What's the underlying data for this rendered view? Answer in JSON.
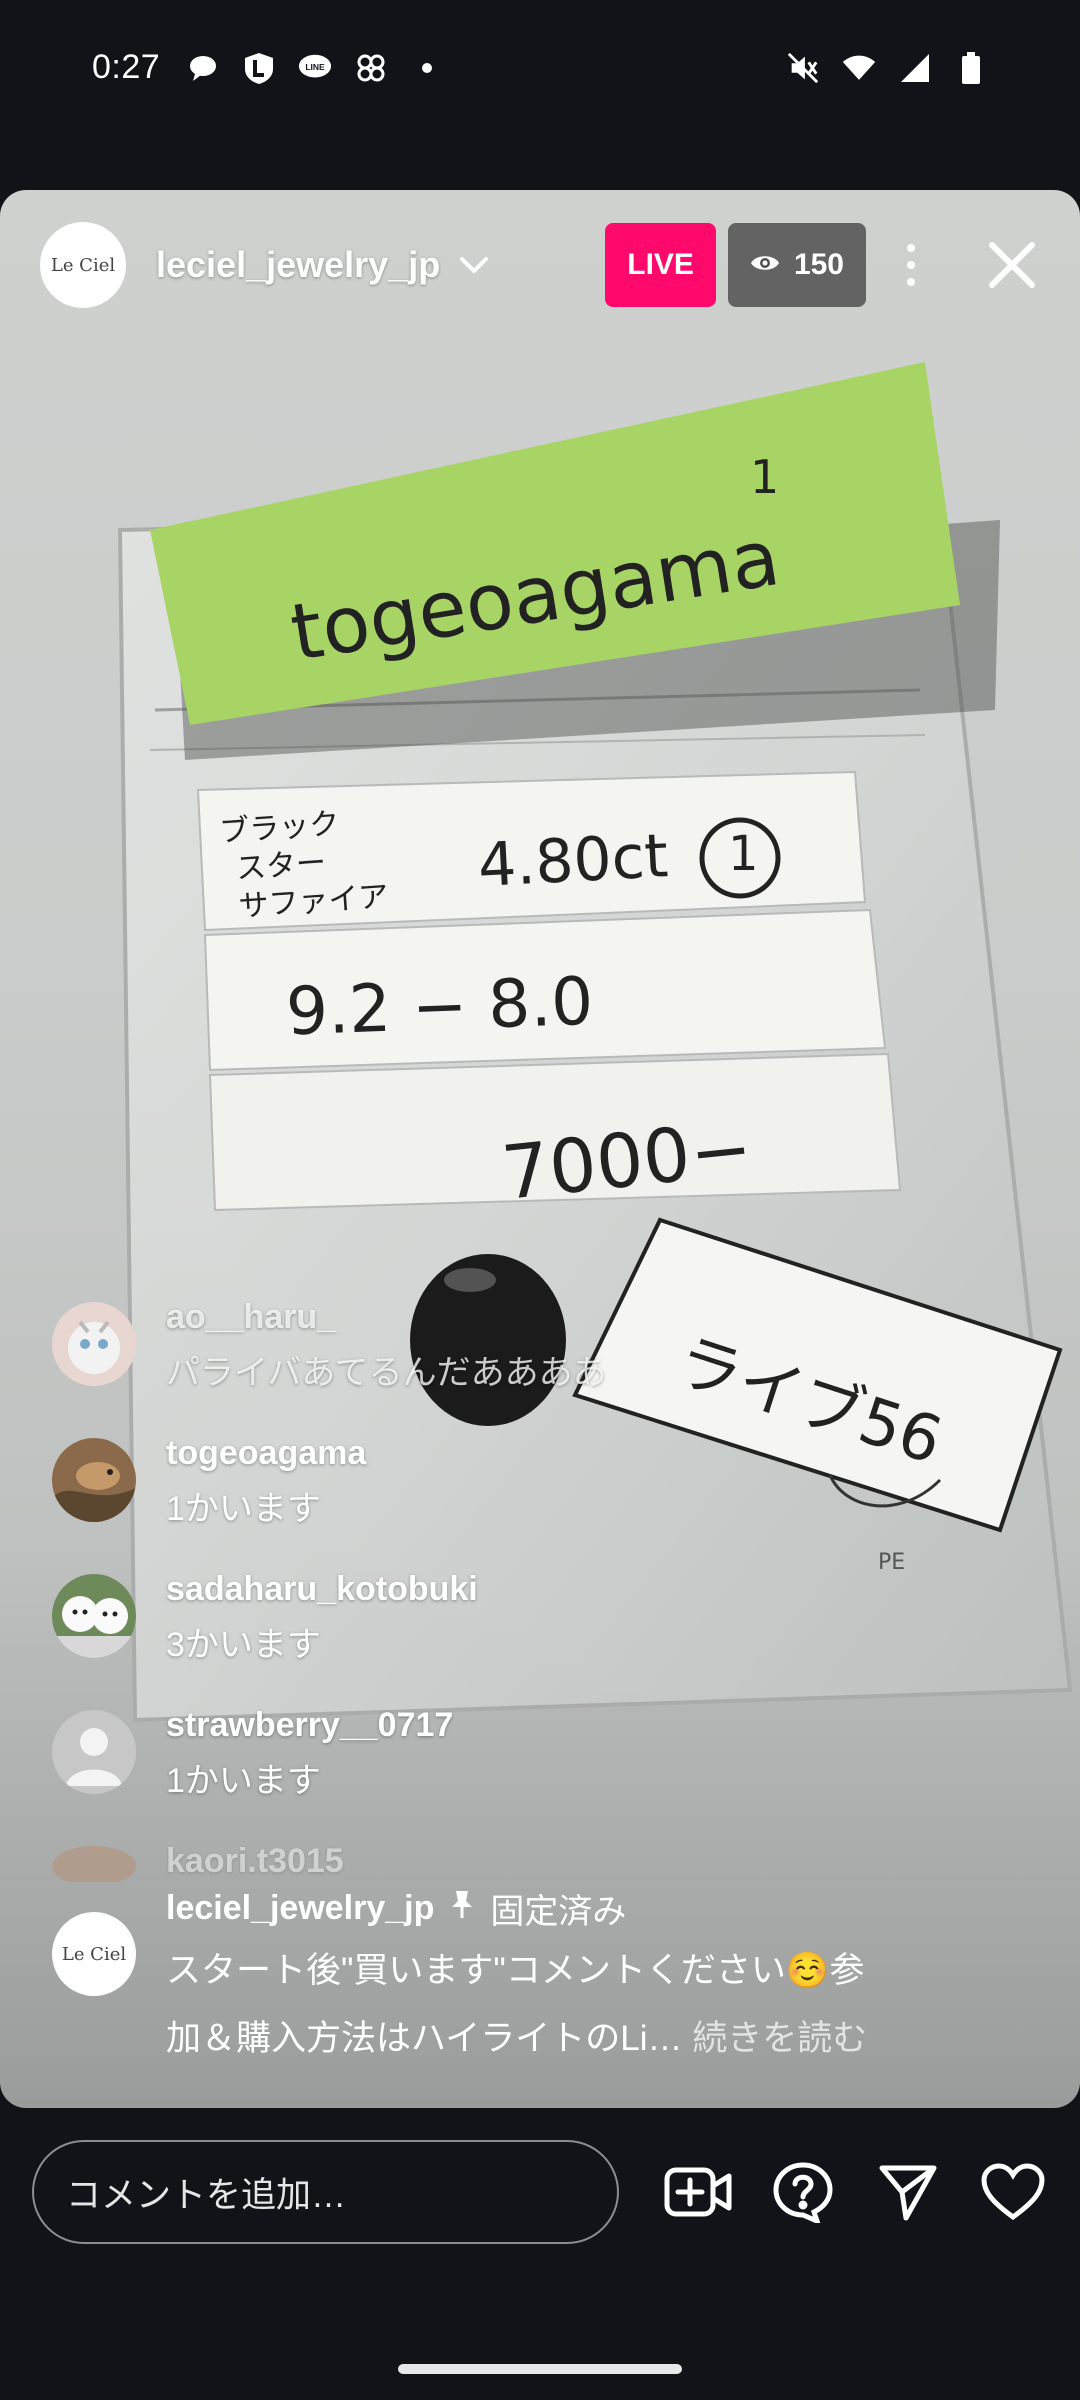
{
  "status_bar": {
    "time": "0:27",
    "left_icons": [
      "chat-bubble-icon",
      "shield-l-icon",
      "line-icon",
      "pinwheel-icon",
      "dot-icon"
    ],
    "right_icons": [
      "mute-icon",
      "wifi-icon",
      "signal-icon",
      "battery-icon"
    ]
  },
  "live": {
    "host": {
      "username": "leciel_jewelry_jp",
      "avatar_text": "Le Ciel"
    },
    "live_label": "LIVE",
    "viewer_count": "150",
    "video": {
      "note_label": "togeoagama",
      "note_number": "1",
      "row1_katakana": [
        "ブラック",
        "スター",
        "サファイア"
      ],
      "row1_weight": "4.80ct",
      "row1_index": "1",
      "row2": "9.2 − 8.0",
      "row3": "7000−",
      "tag": "ライブ56",
      "tag_small": "PE"
    }
  },
  "comments": [
    {
      "user": "ao__haru_",
      "text": "パライバあてるんだああああ",
      "faded": true,
      "avatar": "avatar-ao-haru"
    },
    {
      "user": "togeoagama",
      "text": "1かいます",
      "avatar": "avatar-togeoagama"
    },
    {
      "user": "sadaharu_kotobuki",
      "text": "3かいます",
      "avatar": "avatar-sadaharu"
    },
    {
      "user": "strawberry__0717",
      "text": "1かいます",
      "avatar": "avatar-default"
    },
    {
      "user": "kaori.t3015",
      "text": "",
      "avatar": "avatar-kaori"
    }
  ],
  "pinned": {
    "user": "leciel_jewelry_jp",
    "pinned_label": "固定済み",
    "message_line1": "スタート後\"買います\"コメントください☺️参",
    "message_line2": "加＆購入方法はハイライトのLi…",
    "read_more": "続きを読む"
  },
  "bottom_bar": {
    "comment_placeholder": "コメントを追加…",
    "icons": [
      "add-video-icon",
      "question-icon",
      "send-icon",
      "heart-icon"
    ]
  },
  "colors": {
    "live_badge": "#ff0a6c",
    "background": "#111318",
    "sticky_note": "#a8d466"
  }
}
